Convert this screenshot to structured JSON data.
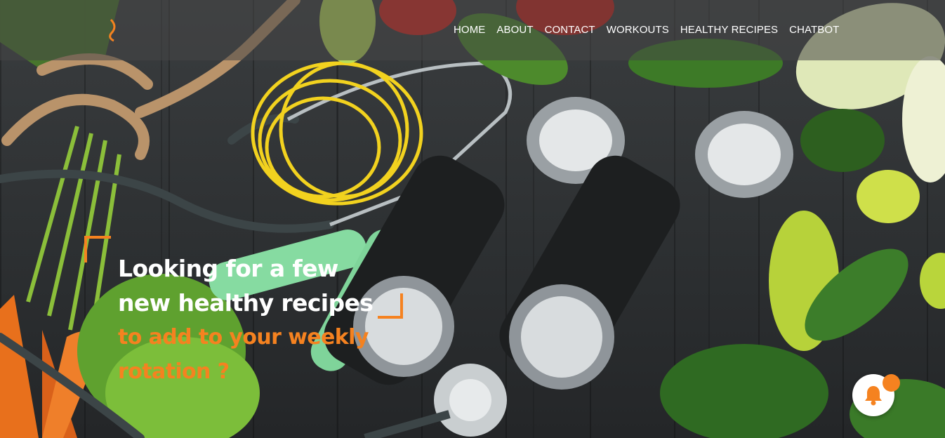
{
  "nav": {
    "items": [
      {
        "label": "HOME"
      },
      {
        "label": "ABOUT"
      },
      {
        "label": "CONTACT"
      },
      {
        "label": "WORKOUTS"
      },
      {
        "label": "HEALTHY RECIPES"
      },
      {
        "label": "CHATBOT"
      }
    ]
  },
  "hero": {
    "headline_line1": "Looking for a few",
    "headline_line2": "new healthy recipes",
    "subline_line1": "to add to your weekly",
    "subline_line2": "rotation ?"
  },
  "notification": {
    "icon": "bell-icon"
  },
  "colors": {
    "accent": "#f58220",
    "nav_text": "#ffffff",
    "headline_text": "#ffffff"
  }
}
